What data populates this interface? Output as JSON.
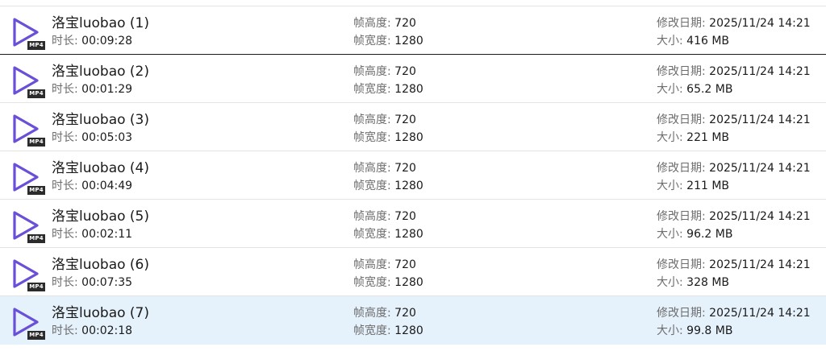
{
  "labels": {
    "duration": "时长:",
    "height": "帧高度:",
    "width": "帧宽度:",
    "modified": "修改日期:",
    "size": "大小:"
  },
  "badge_text": "MP4",
  "icon_name": "video-play-icon",
  "accent_color": "#6a4fd8",
  "files": [
    {
      "name": "洛宝luobao (1)",
      "duration": "00:09:28",
      "height": "720",
      "width": "1280",
      "modified": "2025/11/24 14:21",
      "size": "416 MB",
      "selected": false
    },
    {
      "name": "洛宝luobao (2)",
      "duration": "00:01:29",
      "height": "720",
      "width": "1280",
      "modified": "2025/11/24 14:21",
      "size": "65.2 MB",
      "selected": false
    },
    {
      "name": "洛宝luobao (3)",
      "duration": "00:05:03",
      "height": "720",
      "width": "1280",
      "modified": "2025/11/24 14:21",
      "size": "221 MB",
      "selected": false
    },
    {
      "name": "洛宝luobao (4)",
      "duration": "00:04:49",
      "height": "720",
      "width": "1280",
      "modified": "2025/11/24 14:21",
      "size": "211 MB",
      "selected": false
    },
    {
      "name": "洛宝luobao (5)",
      "duration": "00:02:11",
      "height": "720",
      "width": "1280",
      "modified": "2025/11/24 14:21",
      "size": "96.2 MB",
      "selected": false
    },
    {
      "name": "洛宝luobao (6)",
      "duration": "00:07:35",
      "height": "720",
      "width": "1280",
      "modified": "2025/11/24 14:21",
      "size": "328 MB",
      "selected": false
    },
    {
      "name": "洛宝luobao (7)",
      "duration": "00:02:18",
      "height": "720",
      "width": "1280",
      "modified": "2025/11/24 14:21",
      "size": "99.8 MB",
      "selected": true
    }
  ]
}
